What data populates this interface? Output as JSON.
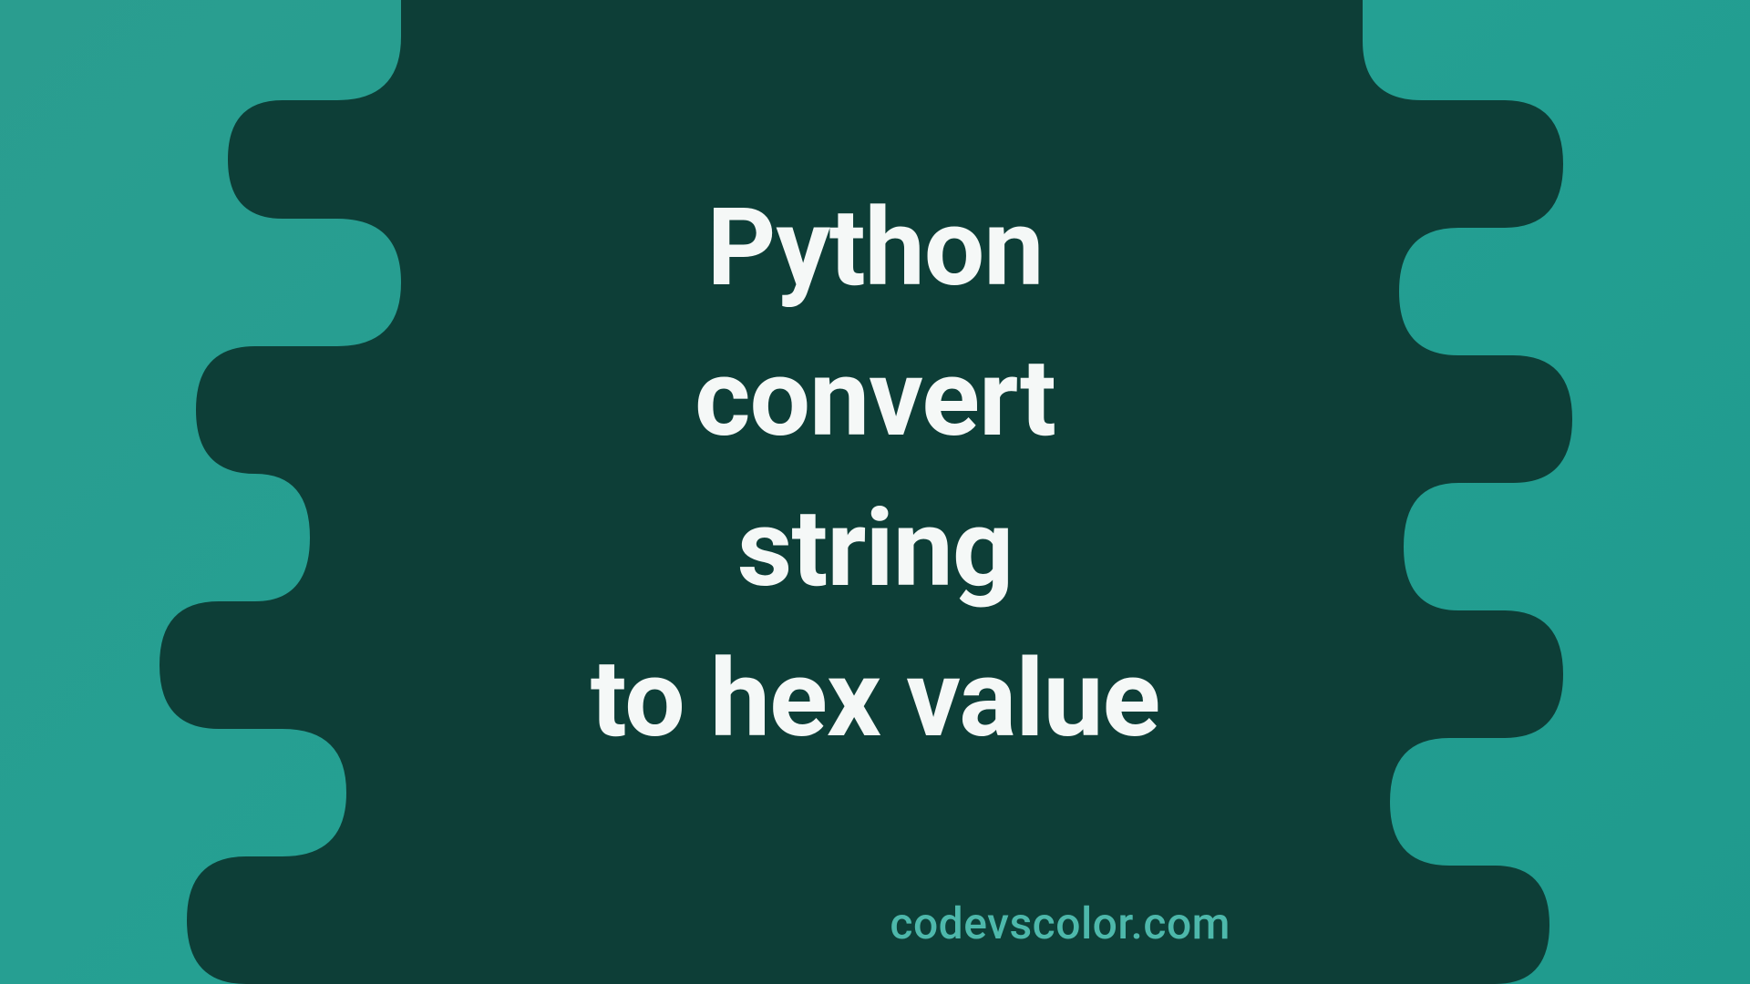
{
  "title": {
    "line1": "Python",
    "line2": "convert",
    "line3": "string",
    "line4": "to hex value"
  },
  "watermark": "codevscolor.com",
  "colors": {
    "background_gradient_start": "#2a9d8f",
    "background_gradient_end": "#1f9a8d",
    "blob_fill": "#0d3e37",
    "text": "#f5f8f7",
    "watermark": "#4db8ab"
  }
}
